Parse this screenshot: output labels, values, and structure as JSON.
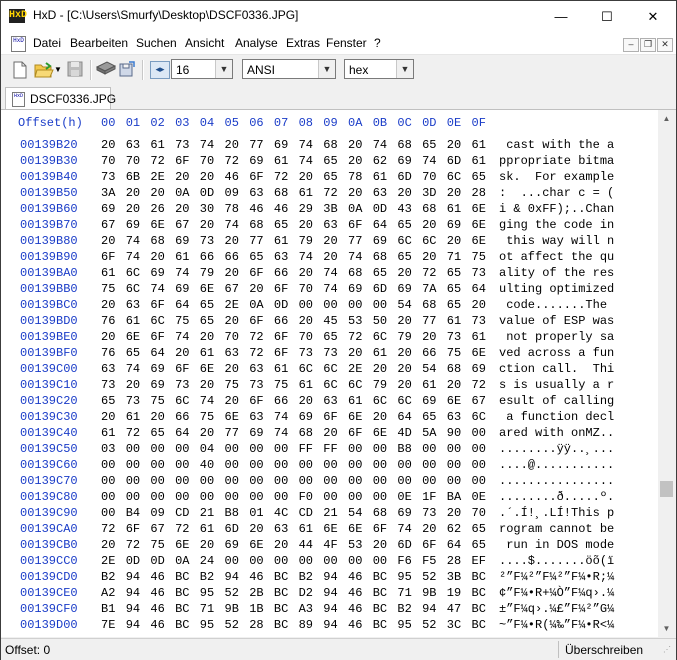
{
  "window": {
    "title": "HxD - [C:\\Users\\Smurfy\\Desktop\\DSCF0336.JPG]",
    "app_icon_text": "HxD",
    "controls": {
      "minimize": "—",
      "maximize": "☐",
      "close": "✕"
    }
  },
  "menu": {
    "icon_text": "HxD",
    "items": [
      "Datei",
      "Bearbeiten",
      "Suchen",
      "Ansicht",
      "Analyse",
      "Extras",
      "Fenster",
      "?"
    ],
    "mdi": {
      "minimize": "‒",
      "restore": "❐",
      "close": "✕"
    }
  },
  "toolbar": {
    "bytes_per_row": "16",
    "charset": "ANSI",
    "display_mode": "hex",
    "icons": [
      "new-file-icon",
      "open-folder-icon",
      "dropdown-arrow-icon",
      "save-disk-icon",
      "ram-chip-icon",
      "open-disk-icon",
      "columns-icon"
    ]
  },
  "tab": {
    "label": "DSCF0336.JPG"
  },
  "hex": {
    "header_offset": "Offset(h)",
    "header_cols": [
      "00",
      "01",
      "02",
      "03",
      "04",
      "05",
      "06",
      "07",
      "08",
      "09",
      "0A",
      "0B",
      "0C",
      "0D",
      "0E",
      "0F"
    ],
    "rows": [
      {
        "offset": "00139B20",
        "hex": [
          "20",
          "63",
          "61",
          "73",
          "74",
          "20",
          "77",
          "69",
          "74",
          "68",
          "20",
          "74",
          "68",
          "65",
          "20",
          "61"
        ],
        "ascii": " cast with the a"
      },
      {
        "offset": "00139B30",
        "hex": [
          "70",
          "70",
          "72",
          "6F",
          "70",
          "72",
          "69",
          "61",
          "74",
          "65",
          "20",
          "62",
          "69",
          "74",
          "6D",
          "61"
        ],
        "ascii": "ppropriate bitma"
      },
      {
        "offset": "00139B40",
        "hex": [
          "73",
          "6B",
          "2E",
          "20",
          "20",
          "46",
          "6F",
          "72",
          "20",
          "65",
          "78",
          "61",
          "6D",
          "70",
          "6C",
          "65"
        ],
        "ascii": "sk.  For example"
      },
      {
        "offset": "00139B50",
        "hex": [
          "3A",
          "20",
          "20",
          "0A",
          "0D",
          "09",
          "63",
          "68",
          "61",
          "72",
          "20",
          "63",
          "20",
          "3D",
          "20",
          "28"
        ],
        "ascii": ":  ...char c = ("
      },
      {
        "offset": "00139B60",
        "hex": [
          "69",
          "20",
          "26",
          "20",
          "30",
          "78",
          "46",
          "46",
          "29",
          "3B",
          "0A",
          "0D",
          "43",
          "68",
          "61",
          "6E"
        ],
        "ascii": "i & 0xFF);..Chan"
      },
      {
        "offset": "00139B70",
        "hex": [
          "67",
          "69",
          "6E",
          "67",
          "20",
          "74",
          "68",
          "65",
          "20",
          "63",
          "6F",
          "64",
          "65",
          "20",
          "69",
          "6E"
        ],
        "ascii": "ging the code in"
      },
      {
        "offset": "00139B80",
        "hex": [
          "20",
          "74",
          "68",
          "69",
          "73",
          "20",
          "77",
          "61",
          "79",
          "20",
          "77",
          "69",
          "6C",
          "6C",
          "20",
          "6E"
        ],
        "ascii": " this way will n"
      },
      {
        "offset": "00139B90",
        "hex": [
          "6F",
          "74",
          "20",
          "61",
          "66",
          "66",
          "65",
          "63",
          "74",
          "20",
          "74",
          "68",
          "65",
          "20",
          "71",
          "75"
        ],
        "ascii": "ot affect the qu"
      },
      {
        "offset": "00139BA0",
        "hex": [
          "61",
          "6C",
          "69",
          "74",
          "79",
          "20",
          "6F",
          "66",
          "20",
          "74",
          "68",
          "65",
          "20",
          "72",
          "65",
          "73"
        ],
        "ascii": "ality of the res"
      },
      {
        "offset": "00139BB0",
        "hex": [
          "75",
          "6C",
          "74",
          "69",
          "6E",
          "67",
          "20",
          "6F",
          "70",
          "74",
          "69",
          "6D",
          "69",
          "7A",
          "65",
          "64"
        ],
        "ascii": "ulting optimized"
      },
      {
        "offset": "00139BC0",
        "hex": [
          "20",
          "63",
          "6F",
          "64",
          "65",
          "2E",
          "0A",
          "0D",
          "00",
          "00",
          "00",
          "00",
          "54",
          "68",
          "65",
          "20"
        ],
        "ascii": " code.......The "
      },
      {
        "offset": "00139BD0",
        "hex": [
          "76",
          "61",
          "6C",
          "75",
          "65",
          "20",
          "6F",
          "66",
          "20",
          "45",
          "53",
          "50",
          "20",
          "77",
          "61",
          "73"
        ],
        "ascii": "value of ESP was"
      },
      {
        "offset": "00139BE0",
        "hex": [
          "20",
          "6E",
          "6F",
          "74",
          "20",
          "70",
          "72",
          "6F",
          "70",
          "65",
          "72",
          "6C",
          "79",
          "20",
          "73",
          "61"
        ],
        "ascii": " not properly sa"
      },
      {
        "offset": "00139BF0",
        "hex": [
          "76",
          "65",
          "64",
          "20",
          "61",
          "63",
          "72",
          "6F",
          "73",
          "73",
          "20",
          "61",
          "20",
          "66",
          "75",
          "6E"
        ],
        "ascii": "ved across a fun"
      },
      {
        "offset": "00139C00",
        "hex": [
          "63",
          "74",
          "69",
          "6F",
          "6E",
          "20",
          "63",
          "61",
          "6C",
          "6C",
          "2E",
          "20",
          "20",
          "54",
          "68",
          "69"
        ],
        "ascii": "ction call.  Thi"
      },
      {
        "offset": "00139C10",
        "hex": [
          "73",
          "20",
          "69",
          "73",
          "20",
          "75",
          "73",
          "75",
          "61",
          "6C",
          "6C",
          "79",
          "20",
          "61",
          "20",
          "72"
        ],
        "ascii": "s is usually a r"
      },
      {
        "offset": "00139C20",
        "hex": [
          "65",
          "73",
          "75",
          "6C",
          "74",
          "20",
          "6F",
          "66",
          "20",
          "63",
          "61",
          "6C",
          "6C",
          "69",
          "6E",
          "67"
        ],
        "ascii": "esult of calling"
      },
      {
        "offset": "00139C30",
        "hex": [
          "20",
          "61",
          "20",
          "66",
          "75",
          "6E",
          "63",
          "74",
          "69",
          "6F",
          "6E",
          "20",
          "64",
          "65",
          "63",
          "6C"
        ],
        "ascii": " a function decl"
      },
      {
        "offset": "00139C40",
        "hex": [
          "61",
          "72",
          "65",
          "64",
          "20",
          "77",
          "69",
          "74",
          "68",
          "20",
          "6F",
          "6E",
          "4D",
          "5A",
          "90",
          "00"
        ],
        "ascii": "ared with onMZ.."
      },
      {
        "offset": "00139C50",
        "hex": [
          "03",
          "00",
          "00",
          "00",
          "04",
          "00",
          "00",
          "00",
          "FF",
          "FF",
          "00",
          "00",
          "B8",
          "00",
          "00",
          "00"
        ],
        "ascii": "........ÿÿ..¸..."
      },
      {
        "offset": "00139C60",
        "hex": [
          "00",
          "00",
          "00",
          "00",
          "40",
          "00",
          "00",
          "00",
          "00",
          "00",
          "00",
          "00",
          "00",
          "00",
          "00",
          "00"
        ],
        "ascii": "....@..........."
      },
      {
        "offset": "00139C70",
        "hex": [
          "00",
          "00",
          "00",
          "00",
          "00",
          "00",
          "00",
          "00",
          "00",
          "00",
          "00",
          "00",
          "00",
          "00",
          "00",
          "00"
        ],
        "ascii": "................"
      },
      {
        "offset": "00139C80",
        "hex": [
          "00",
          "00",
          "00",
          "00",
          "00",
          "00",
          "00",
          "00",
          "F0",
          "00",
          "00",
          "00",
          "0E",
          "1F",
          "BA",
          "0E"
        ],
        "ascii": "........ð.....º."
      },
      {
        "offset": "00139C90",
        "hex": [
          "00",
          "B4",
          "09",
          "CD",
          "21",
          "B8",
          "01",
          "4C",
          "CD",
          "21",
          "54",
          "68",
          "69",
          "73",
          "20",
          "70"
        ],
        "ascii": ".´.Í!¸.LÍ!This p"
      },
      {
        "offset": "00139CA0",
        "hex": [
          "72",
          "6F",
          "67",
          "72",
          "61",
          "6D",
          "20",
          "63",
          "61",
          "6E",
          "6E",
          "6F",
          "74",
          "20",
          "62",
          "65"
        ],
        "ascii": "rogram cannot be"
      },
      {
        "offset": "00139CB0",
        "hex": [
          "20",
          "72",
          "75",
          "6E",
          "20",
          "69",
          "6E",
          "20",
          "44",
          "4F",
          "53",
          "20",
          "6D",
          "6F",
          "64",
          "65"
        ],
        "ascii": " run in DOS mode"
      },
      {
        "offset": "00139CC0",
        "hex": [
          "2E",
          "0D",
          "0D",
          "0A",
          "24",
          "00",
          "00",
          "00",
          "00",
          "00",
          "00",
          "00",
          "F6",
          "F5",
          "28",
          "EF"
        ],
        "ascii": "....$.......öõ(ï"
      },
      {
        "offset": "00139CD0",
        "hex": [
          "B2",
          "94",
          "46",
          "BC",
          "B2",
          "94",
          "46",
          "BC",
          "B2",
          "94",
          "46",
          "BC",
          "95",
          "52",
          "3B",
          "BC"
        ],
        "ascii": "²”F¼²”F¼²”F¼•R;¼"
      },
      {
        "offset": "00139CE0",
        "hex": [
          "A2",
          "94",
          "46",
          "BC",
          "95",
          "52",
          "2B",
          "BC",
          "D2",
          "94",
          "46",
          "BC",
          "71",
          "9B",
          "19",
          "BC"
        ],
        "ascii": "¢”F¼•R+¼Ò”F¼q›.¼"
      },
      {
        "offset": "00139CF0",
        "hex": [
          "B1",
          "94",
          "46",
          "BC",
          "71",
          "9B",
          "1B",
          "BC",
          "A3",
          "94",
          "46",
          "BC",
          "B2",
          "94",
          "47",
          "BC"
        ],
        "ascii": "±”F¼q›.¼£”F¼²”G¼"
      },
      {
        "offset": "00139D00",
        "hex": [
          "7E",
          "94",
          "46",
          "BC",
          "95",
          "52",
          "28",
          "BC",
          "89",
          "94",
          "46",
          "BC",
          "95",
          "52",
          "3C",
          "BC"
        ],
        "ascii": "~”F¼•R(¼‰”F¼•R<¼"
      }
    ]
  },
  "status": {
    "offset": "Offset: 0",
    "mode": "Überschreiben"
  }
}
